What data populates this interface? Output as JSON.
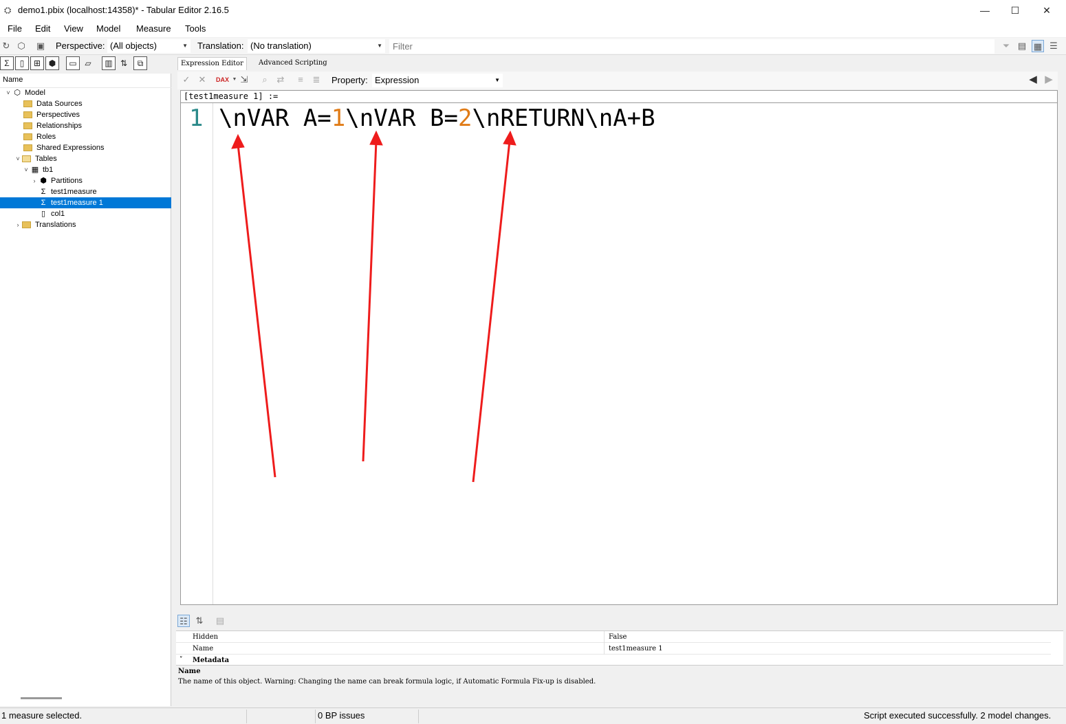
{
  "window": {
    "title": "demo1.pbix (localhost:14358)* - Tabular Editor 2.16.5",
    "minimize": "—",
    "maximize": "☐",
    "close": "✕"
  },
  "menu": {
    "items": [
      {
        "label": "File"
      },
      {
        "label": "Edit"
      },
      {
        "label": "View"
      },
      {
        "label": "Model"
      },
      {
        "label": "Measure"
      },
      {
        "label": "Tools"
      }
    ]
  },
  "toolbar": {
    "perspective_label": "Perspective:",
    "perspective_value": "(All objects)",
    "translation_label": "Translation:",
    "translation_value": "(No translation)",
    "filter_placeholder": "Filter"
  },
  "tree": {
    "header": "Name",
    "nodes": [
      {
        "label": "Model"
      },
      {
        "label": "Data Sources"
      },
      {
        "label": "Perspectives"
      },
      {
        "label": "Relationships"
      },
      {
        "label": "Roles"
      },
      {
        "label": "Shared Expressions"
      },
      {
        "label": "Tables"
      },
      {
        "label": "tb1"
      },
      {
        "label": "Partitions"
      },
      {
        "label": "test1measure"
      },
      {
        "label": "test1measure 1"
      },
      {
        "label": "col1"
      },
      {
        "label": "Translations"
      }
    ]
  },
  "editor": {
    "tabs": [
      {
        "label": "Expression Editor"
      },
      {
        "label": "Advanced Scripting"
      }
    ],
    "property_label": "Property:",
    "property_value": "Expression",
    "header": "[test1measure 1] :=",
    "line_number": "1",
    "code_parts": [
      "\\nVAR A=",
      "1",
      "\\nVAR B=",
      "2",
      "\\nRETURN\\nA+B"
    ],
    "number_color": "#e07b16"
  },
  "properties": {
    "rows": [
      {
        "key": "Hidden",
        "value": "False"
      },
      {
        "key": "Name",
        "value": "test1measure 1"
      }
    ],
    "category": "Metadata",
    "desc_title": "Name",
    "desc_text": "The name of this object. Warning: Changing the name can break formula logic, if Automatic Formula Fix-up is disabled."
  },
  "status": {
    "selection": "1 measure selected.",
    "bp_issues": "0 BP issues",
    "message": "Script executed successfully. 2 model changes."
  },
  "colors": {
    "selection": "#0078d7",
    "annotation_arrow": "#ee1c1c"
  }
}
